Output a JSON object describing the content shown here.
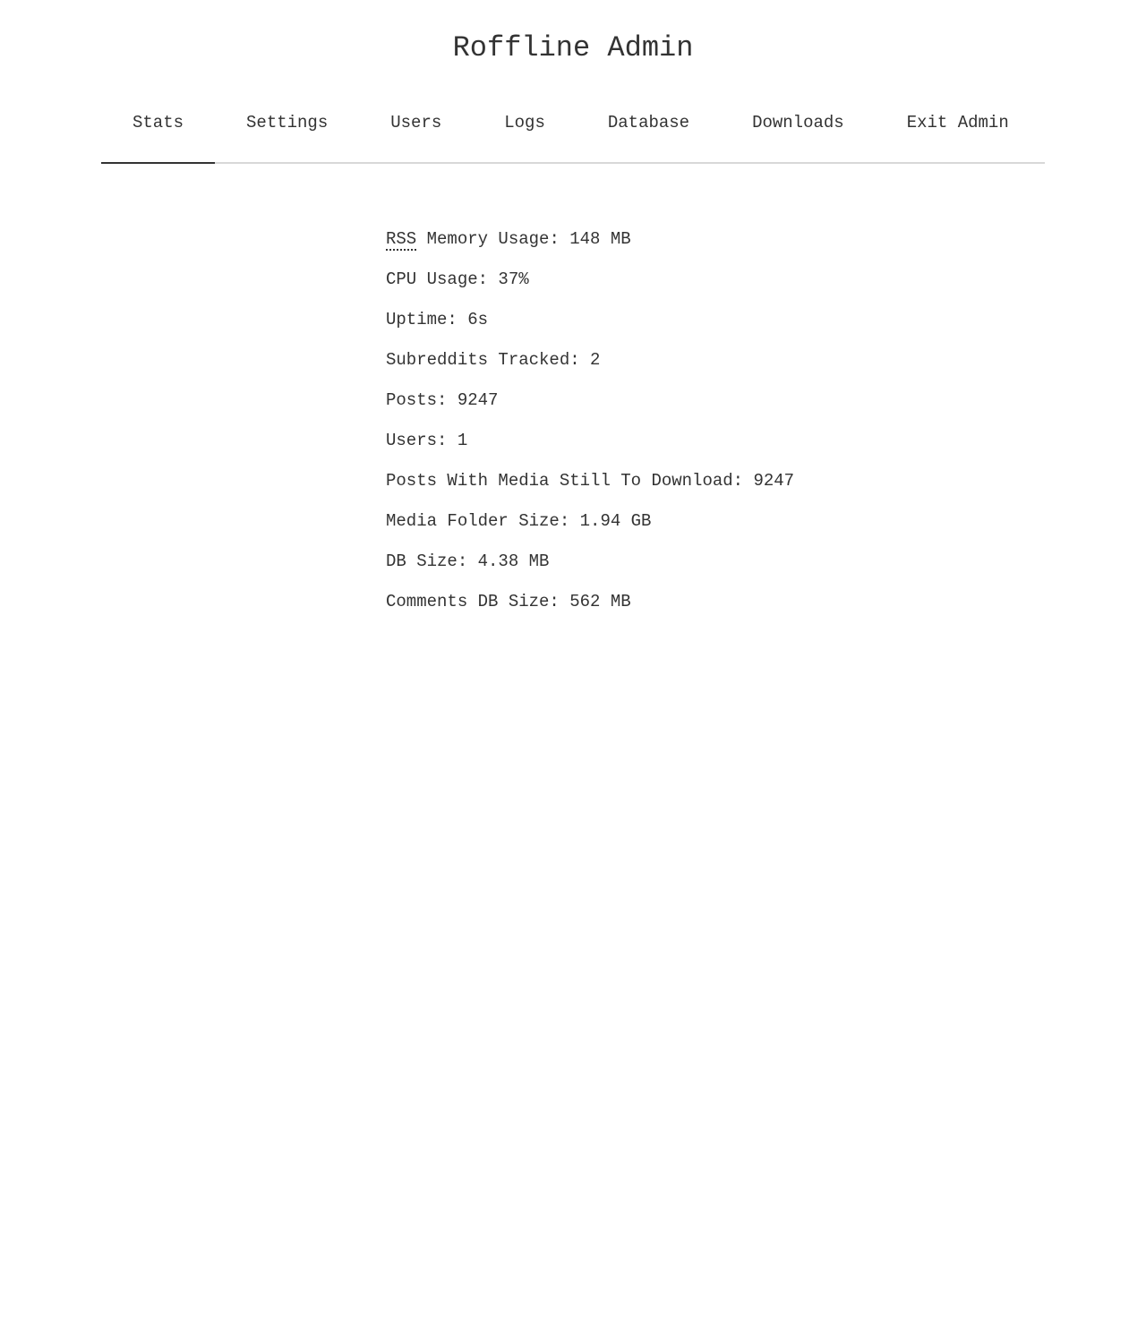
{
  "header": {
    "title": "Roffline Admin"
  },
  "tabs": [
    {
      "label": "Stats",
      "active": true
    },
    {
      "label": "Settings",
      "active": false
    },
    {
      "label": "Users",
      "active": false
    },
    {
      "label": "Logs",
      "active": false
    },
    {
      "label": "Database",
      "active": false
    },
    {
      "label": "Downloads",
      "active": false
    },
    {
      "label": "Exit Admin",
      "active": false
    }
  ],
  "stats": {
    "rss_abbr": "RSS",
    "rss_label": " Memory Usage: ",
    "rss_value": "148 MB",
    "cpu_label": "CPU Usage: ",
    "cpu_value": "37%",
    "uptime_label": "Uptime: ",
    "uptime_value": "6s",
    "subreddits_label": "Subreddits Tracked: ",
    "subreddits_value": "2",
    "posts_label": "Posts: ",
    "posts_value": "9247",
    "users_label": "Users: ",
    "users_value": "1",
    "pending_media_label": "Posts With Media Still To Download: ",
    "pending_media_value": "9247",
    "media_folder_label": "Media Folder Size: ",
    "media_folder_value": "1.94 GB",
    "db_size_label": "DB Size: ",
    "db_size_value": "4.38 MB",
    "comments_db_label": "Comments DB Size: ",
    "comments_db_value": "562 MB"
  },
  "colors": {
    "text": "#333333",
    "tab_border": "#d8d8d8",
    "active_tab_indicator": "#333333"
  }
}
